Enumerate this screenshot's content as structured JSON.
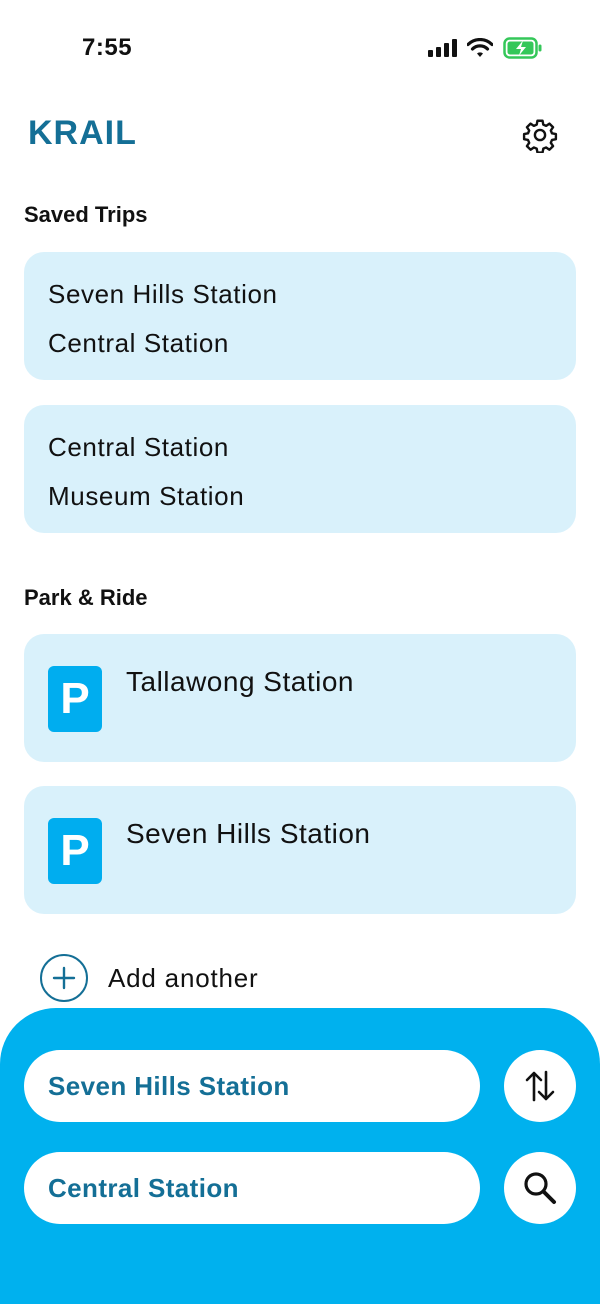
{
  "status_bar": {
    "time": "7:55",
    "icons": [
      "cellular-signal-icon",
      "wifi-icon",
      "battery-charging-icon"
    ],
    "battery_color": "#34c759"
  },
  "header": {
    "title": "KRAIL",
    "settings_icon": "gear-icon"
  },
  "saved_trips": {
    "heading": "Saved Trips",
    "items": [
      {
        "from": "Seven Hills Station",
        "to": "Central Station"
      },
      {
        "from": "Central Station",
        "to": "Museum Station"
      }
    ]
  },
  "park_ride": {
    "heading": "Park & Ride",
    "icon_letter": "P",
    "items": [
      {
        "name": "Tallawong Station"
      },
      {
        "name": "Seven Hills Station"
      }
    ],
    "add_label": "Add another"
  },
  "search_panel": {
    "from": "Seven Hills Station",
    "to": "Central Station",
    "swap_icon": "swap-arrows-icon",
    "search_icon": "search-icon"
  },
  "colors": {
    "brand": "#146f96",
    "panel": "#00b1ee",
    "card": "#d9f1fb",
    "parking": "#00adef"
  }
}
